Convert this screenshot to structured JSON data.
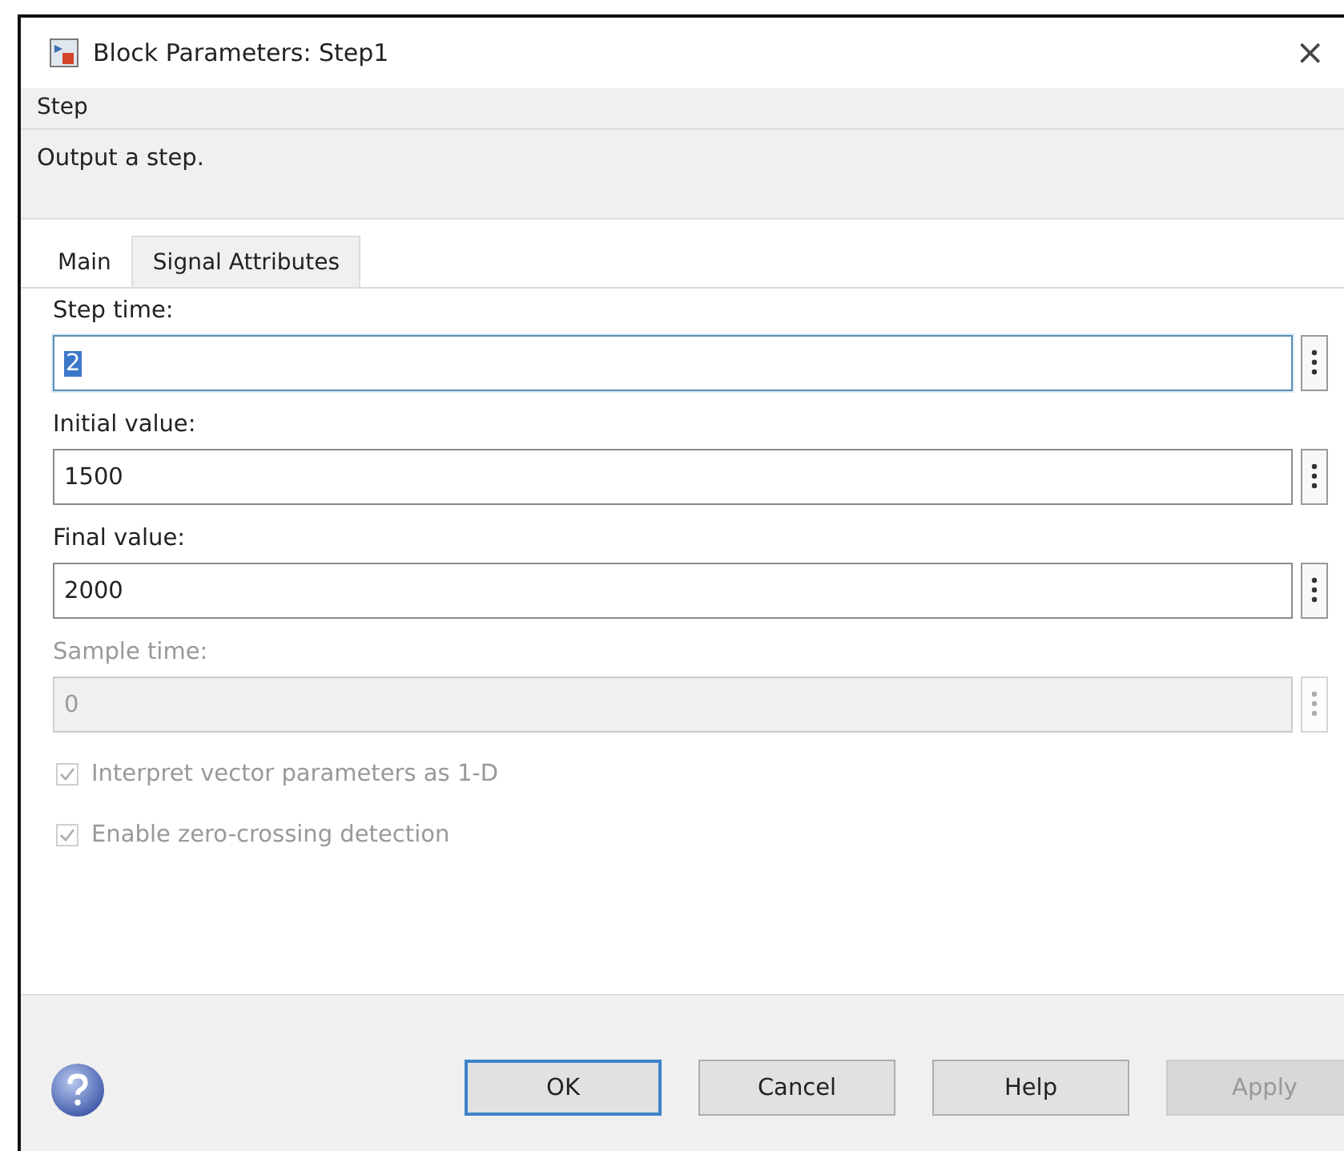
{
  "window": {
    "title": "Block Parameters: Step1",
    "close": "×"
  },
  "group": {
    "title": "Step",
    "description": "Output a step."
  },
  "tabs": [
    {
      "label": "Main",
      "selected": true
    },
    {
      "label": "Signal Attributes",
      "selected": false
    }
  ],
  "parameters": [
    {
      "label": "Step time:",
      "value": "2",
      "focused": true,
      "disabled": false
    },
    {
      "label": "Initial value:",
      "value": "1500",
      "focused": false,
      "disabled": false
    },
    {
      "label": "Final value:",
      "value": "2000",
      "focused": false,
      "disabled": false
    },
    {
      "label": "Sample time:",
      "value": "0",
      "focused": false,
      "disabled": true
    }
  ],
  "checkboxes": [
    {
      "label": "Interpret vector parameters as 1-D",
      "checked": true,
      "disabled": true
    },
    {
      "label": "Enable zero-crossing detection",
      "checked": true,
      "disabled": true
    }
  ],
  "buttons": [
    {
      "label": "OK",
      "default": true,
      "disabled": false
    },
    {
      "label": "Cancel",
      "default": false,
      "disabled": false
    },
    {
      "label": "Help",
      "default": false,
      "disabled": false
    },
    {
      "label": "Apply",
      "default": false,
      "disabled": true
    }
  ]
}
